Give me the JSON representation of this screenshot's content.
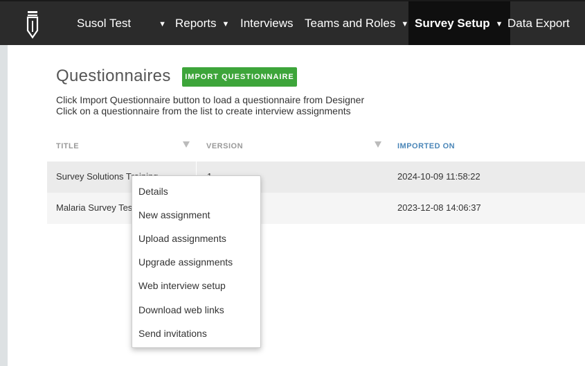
{
  "nav": {
    "items": [
      {
        "label": "Susol Test",
        "caret": "▼"
      },
      {
        "label": "Reports",
        "caret": "▼"
      },
      {
        "label": "Interviews"
      },
      {
        "label": "Teams and Roles",
        "caret": "▼"
      },
      {
        "label": "Survey Setup",
        "caret": "▼",
        "active": true
      },
      {
        "label": "Data Export"
      }
    ]
  },
  "page": {
    "title": "Questionnaires",
    "import_button": "IMPORT QUESTIONNAIRE",
    "instructions": [
      "Click Import Questionnaire button to load a questionnaire from Designer",
      "Click on a questionnaire from the list to create interview assignments"
    ]
  },
  "table": {
    "headers": {
      "title": "TITLE",
      "version": "VERSION",
      "imported_on": "IMPORTED ON"
    },
    "rows": [
      {
        "title": "Survey Solutions Training",
        "version": "1",
        "imported_on": "2024-10-09 11:58:22"
      },
      {
        "title": "Malaria Survey Test",
        "version": "",
        "imported_on": "2023-12-08 14:06:37"
      }
    ]
  },
  "context_menu": {
    "items": [
      "Details",
      "New assignment",
      "Upload assignments",
      "Upgrade assignments",
      "Web interview setup",
      "Download web links",
      "Send invitations"
    ]
  },
  "colors": {
    "topbar": "#2b2b2b",
    "accent_green": "#3da53a",
    "sorted_header": "#4a86b8"
  }
}
